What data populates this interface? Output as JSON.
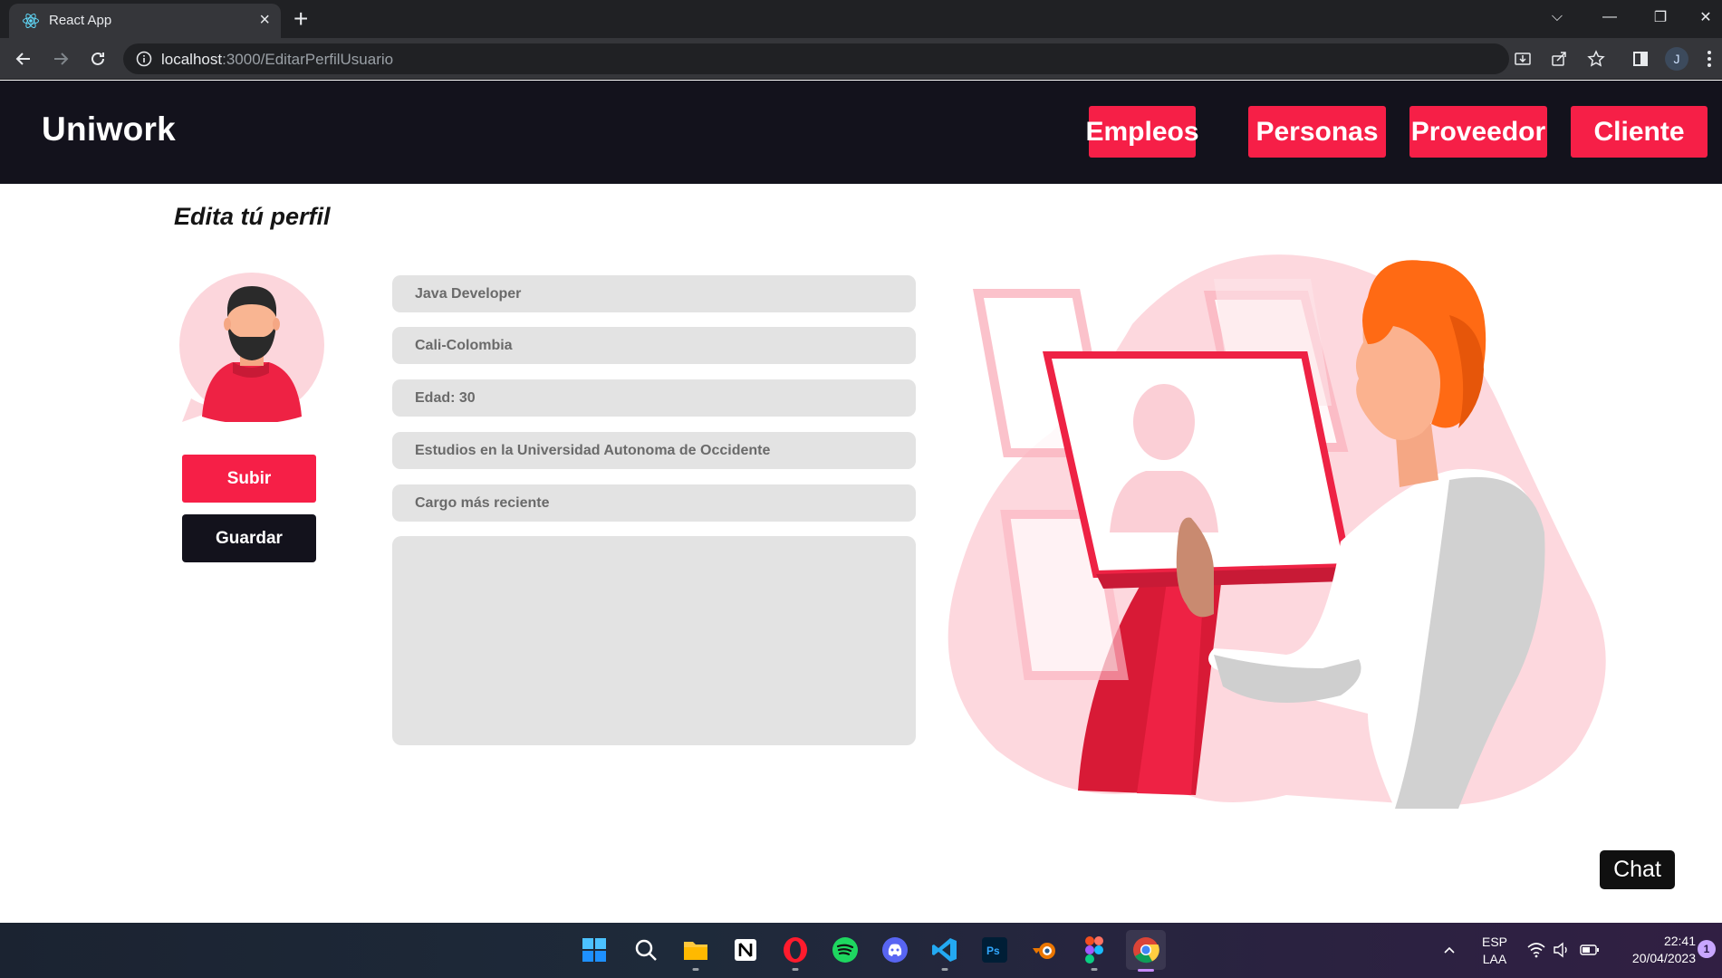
{
  "browser": {
    "tab_title": "React App",
    "tab_close": "×",
    "new_tab": "+",
    "url_host": "localhost",
    "url_path": ":3000/EditarPerfilUsuario",
    "window_controls": {
      "menu": "⌵",
      "minimize": "—",
      "restore": "❐",
      "close": "✕"
    },
    "profile_initial": "J"
  },
  "app": {
    "brand": "Uniwork",
    "nav": [
      {
        "label": "Empleos"
      },
      {
        "label": "Personas"
      },
      {
        "label": "Proveedor"
      },
      {
        "label": "Cliente"
      }
    ],
    "accent": "#f61f47",
    "dark": "#13121c"
  },
  "profile": {
    "title": "Edita tú perfil",
    "upload_label": "Subir",
    "save_label": "Guardar",
    "fields": [
      {
        "value": "Java Developer"
      },
      {
        "value": "Cali-Colombia"
      },
      {
        "value": "Edad: 30"
      },
      {
        "value": "Estudios en la Universidad Autonoma de Occidente"
      },
      {
        "value": "Cargo más reciente"
      }
    ],
    "description": ""
  },
  "chat": {
    "label": "Chat"
  },
  "taskbar": {
    "apps": [
      "windows-start",
      "search",
      "file-explorer",
      "notion",
      "opera",
      "spotify",
      "discord",
      "vscode",
      "photoshop",
      "blender",
      "figma",
      "chrome"
    ],
    "language": [
      "ESP",
      "LAA"
    ],
    "time": "22:41",
    "date": "20/04/2023",
    "notifications": "1"
  }
}
